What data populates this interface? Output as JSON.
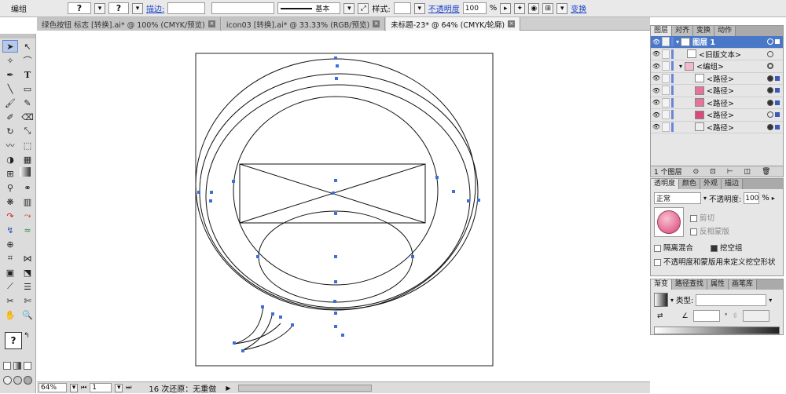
{
  "control_bar": {
    "object_type": "编组",
    "stroke_label": "描边:",
    "stroke_profile": "基本",
    "style_label": "样式:",
    "opacity_label": "不透明度",
    "opacity_value": "100",
    "opacity_unit": "%",
    "transform_label": "变换"
  },
  "tabs": [
    {
      "label": "绿色按钮 标志 [转换].ai* @ 100% (CMYK/预览)",
      "close": "×"
    },
    {
      "label": "icon03 [转换].ai* @ 33.33% (RGB/预览)",
      "close": "×"
    },
    {
      "label": "未标题-23* @ 64% (CMYK/轮廓)",
      "close": "×"
    }
  ],
  "status_bar": {
    "zoom": "64%",
    "page": "1",
    "undo_text": "16 次还原：无重做"
  },
  "layers_panel": {
    "tabs": [
      "图层",
      "对齐",
      "变换",
      "动作"
    ],
    "rows": [
      {
        "label": "图层 1",
        "depth": 0,
        "selected": true
      },
      {
        "label": "<旧版文本>",
        "depth": 1,
        "selected": false
      },
      {
        "label": "<编组>",
        "depth": 1,
        "selected": false
      },
      {
        "label": "<路径>",
        "depth": 2,
        "selected": false
      },
      {
        "label": "<路径>",
        "depth": 2,
        "selected": false
      },
      {
        "label": "<路径>",
        "depth": 2,
        "selected": false
      },
      {
        "label": "<路径>",
        "depth": 2,
        "selected": false
      },
      {
        "label": "<路径>",
        "depth": 2,
        "selected": false
      }
    ],
    "footer": "1 个图层"
  },
  "transparency_panel": {
    "tabs": [
      "透明度",
      "颜色",
      "外观",
      "描边"
    ],
    "blend_mode": "正常",
    "opacity_label": "不透明度:",
    "opacity_value": "100",
    "opacity_unit": "%",
    "clip_label": "剪切",
    "invert_mask_label": "反相蒙版",
    "isolate_blend_label": "隔离混合",
    "knockout_group_label": "挖空组",
    "opacity_mask_label": "不透明度和蒙版用来定义挖空形状"
  },
  "gradient_panel": {
    "tabs": [
      "渐变",
      "路径查找",
      "属性",
      "画笔库"
    ],
    "type_label": "类型:"
  },
  "colors": {
    "accent_blue": "#4a78c8",
    "anchor_blue": "#3d6fd9",
    "pink_swatch": "#e6749a",
    "link_blue": "#1d43c9"
  },
  "icons": {
    "selection": "selection-arrow-icon",
    "direct_selection": "direct-selection-icon",
    "magic_wand": "magic-wand-icon",
    "lasso": "lasso-icon",
    "pen": "pen-icon",
    "type": "type-icon",
    "line": "line-segment-icon",
    "rectangle": "rectangle-icon",
    "paintbrush": "paintbrush-icon",
    "pencil": "pencil-icon",
    "blob_brush": "blob-brush-icon",
    "eraser": "eraser-icon",
    "rotate": "rotate-icon",
    "scale": "scale-icon",
    "warp": "warp-icon",
    "free_transform": "free-transform-icon",
    "shape_builder": "shape-builder-icon",
    "perspective": "perspective-grid-icon",
    "mesh": "mesh-icon",
    "gradient": "gradient-icon",
    "eyedropper": "eyedropper-icon",
    "blend": "blend-icon",
    "symbol_sprayer": "symbol-sprayer-icon",
    "graph": "column-graph-icon",
    "artboard": "artboard-icon",
    "slice": "slice-icon",
    "hand": "hand-icon",
    "zoom": "zoom-icon"
  }
}
